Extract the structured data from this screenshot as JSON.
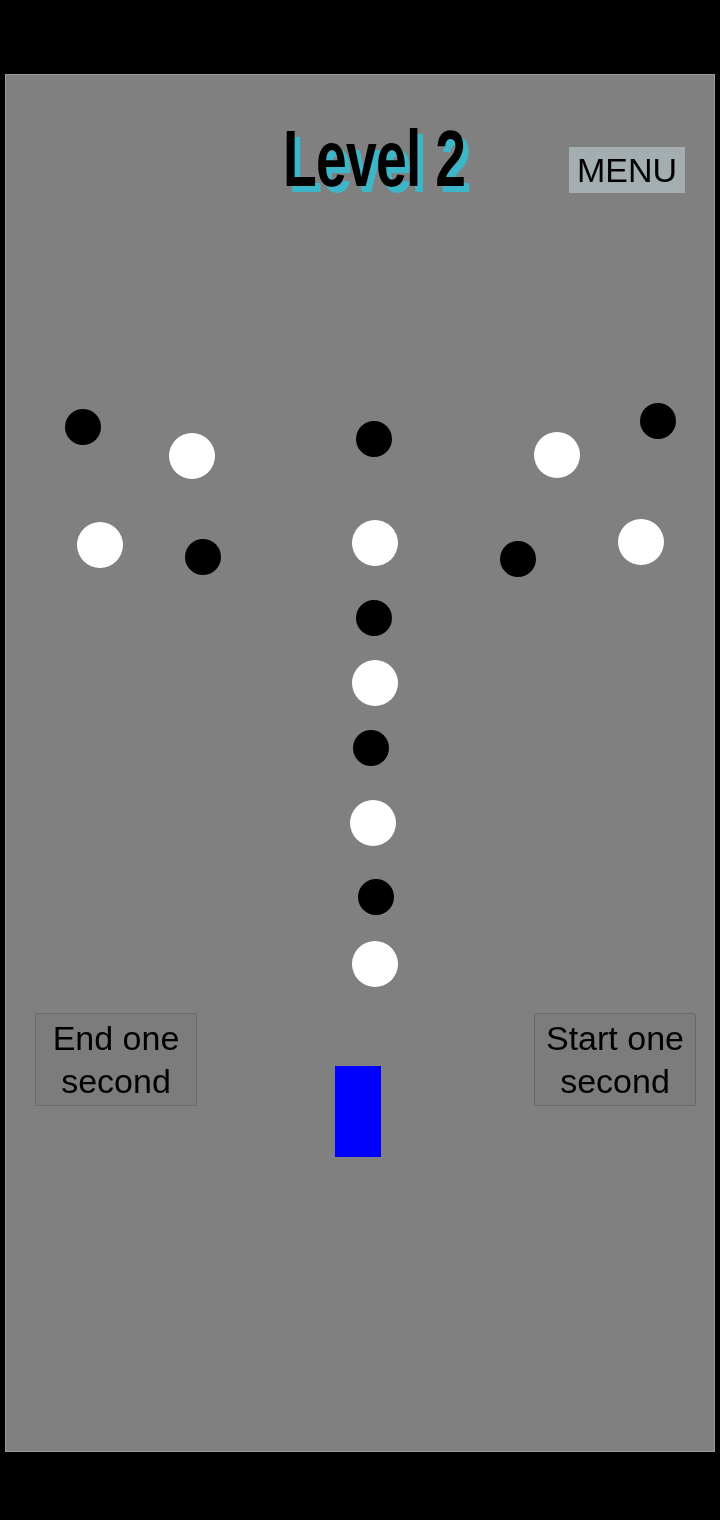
{
  "title": "Level 2",
  "menu_button": {
    "label": "MENU"
  },
  "dots": [
    {
      "color": "#000000"
    },
    {
      "color": "#ffffff"
    },
    {
      "color": "#000000"
    },
    {
      "color": "#ffffff"
    },
    {
      "color": "#000000"
    },
    {
      "color": "#ffffff"
    },
    {
      "color": "#000000"
    },
    {
      "color": "#ffffff"
    },
    {
      "color": "#000000"
    },
    {
      "color": "#ffffff"
    },
    {
      "color": "#000000"
    },
    {
      "color": "#ffffff"
    },
    {
      "color": "#000000"
    },
    {
      "color": "#ffffff"
    },
    {
      "color": "#000000"
    },
    {
      "color": "#ffffff"
    }
  ],
  "buttons": [
    {
      "label": "End one second"
    },
    {
      "label": "Start one second"
    }
  ]
}
